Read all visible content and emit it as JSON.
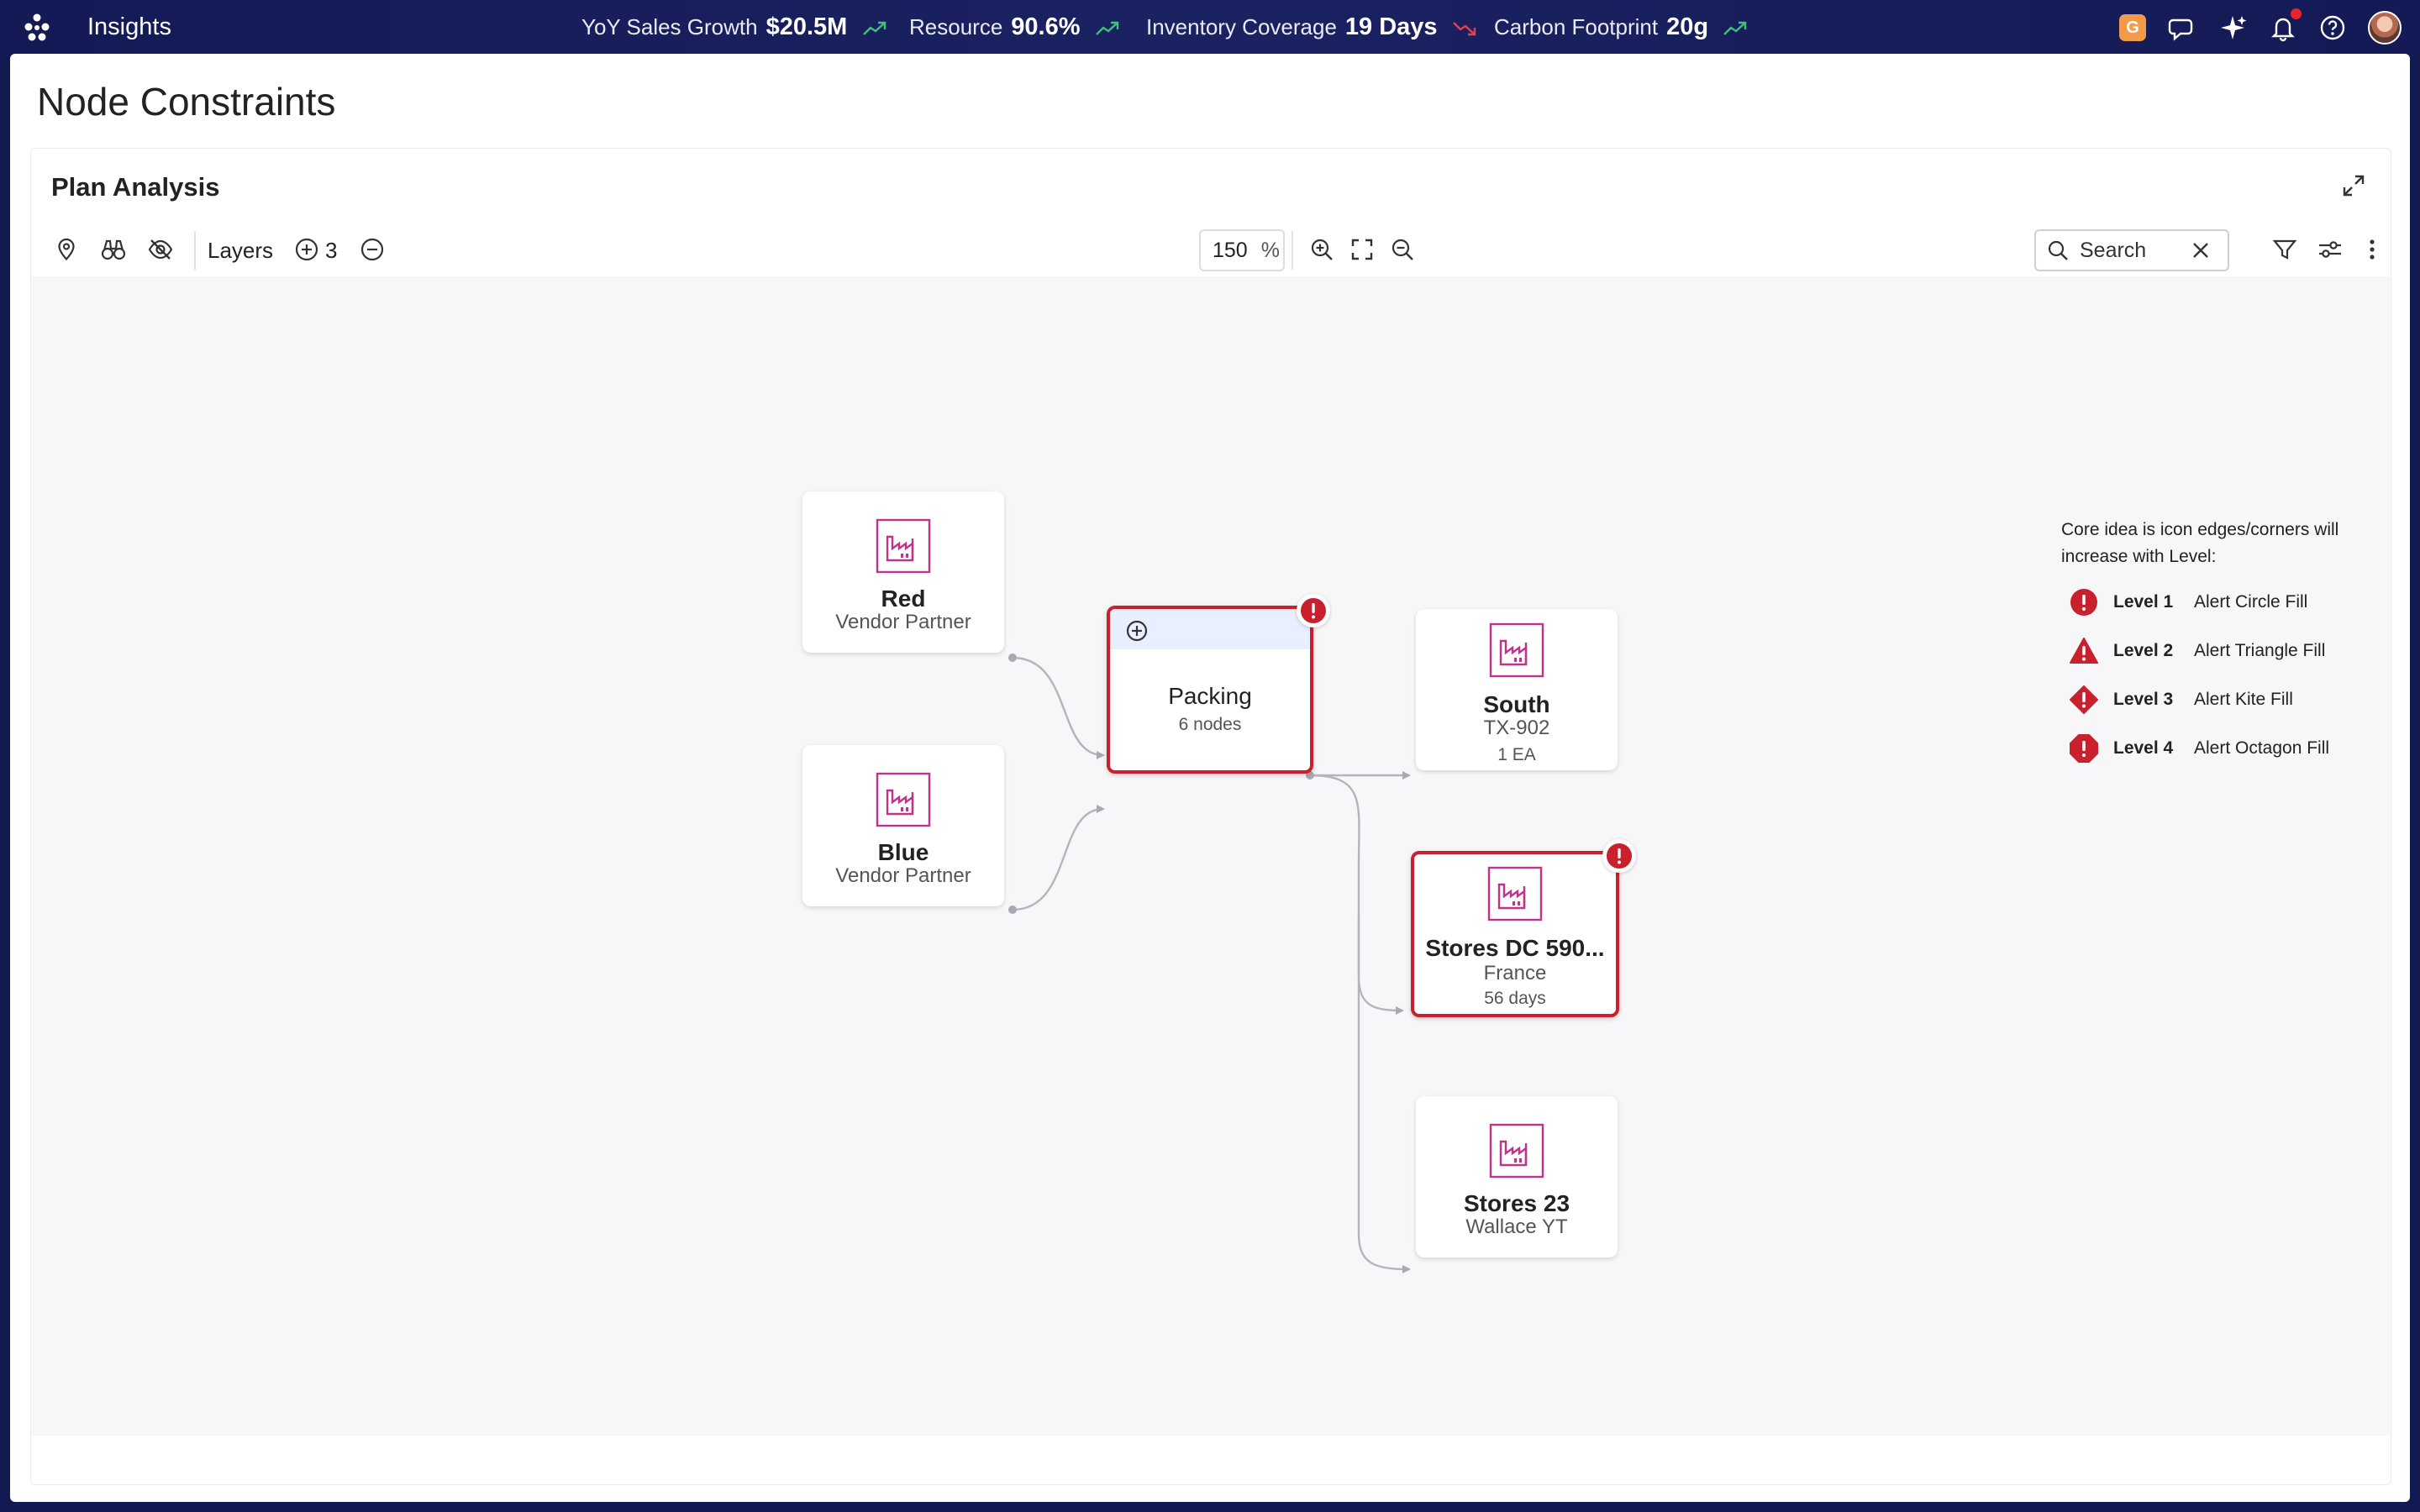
{
  "app": {
    "title": "Insights"
  },
  "metrics": [
    {
      "label": "YoY Sales Growth",
      "value": "$20.5M",
      "trend": "up"
    },
    {
      "label": "Resource",
      "value": "90.6%",
      "trend": "up"
    },
    {
      "label": "Inventory Coverage",
      "value": "19 Days",
      "trend": "down"
    },
    {
      "label": "Carbon Footprint",
      "value": "20g",
      "trend": "up"
    }
  ],
  "header_icons": [
    "g-app-badge",
    "chat-icon",
    "sparkle-icon",
    "bell-icon",
    "help-icon",
    "avatar"
  ],
  "header": {
    "app_badge": "G"
  },
  "page": {
    "title": "Node Constraints"
  },
  "card": {
    "title": "Plan Analysis"
  },
  "toolbar": {
    "layers_label": "Layers",
    "layers_count": "3",
    "zoom_value": "150",
    "zoom_unit": "%",
    "search_placeholder": "Search"
  },
  "nodes": {
    "red": {
      "name": "Red",
      "sub": "Vendor Partner"
    },
    "blue": {
      "name": "Blue",
      "sub": "Vendor Partner"
    },
    "packing": {
      "name": "Packing",
      "sub": "6 nodes",
      "alert": true
    },
    "south": {
      "name": "South",
      "sub": "TX-902",
      "meta": "1 EA"
    },
    "stores_dc": {
      "name": "Stores DC 590...",
      "sub": "France",
      "meta": "56 days",
      "alert": true
    },
    "stores23": {
      "name": "Stores 23",
      "sub": "Wallace YT"
    }
  },
  "legend": {
    "note": "Core idea is icon edges/corners will increase with Level:",
    "items": [
      {
        "level": "Level 1",
        "label": "Alert Circle Fill"
      },
      {
        "level": "Level 2",
        "label": "Alert Triangle Fill"
      },
      {
        "level": "Level 3",
        "label": "Alert Kite Fill"
      },
      {
        "level": "Level 4",
        "label": "Alert Octagon Fill"
      }
    ]
  },
  "colors": {
    "topbar": "#141a55",
    "alert": "#c8202c",
    "node_icon": "#c0338a",
    "trend_up": "#3ec27a",
    "trend_down": "#e0444f",
    "group_header": "#e9efff"
  }
}
